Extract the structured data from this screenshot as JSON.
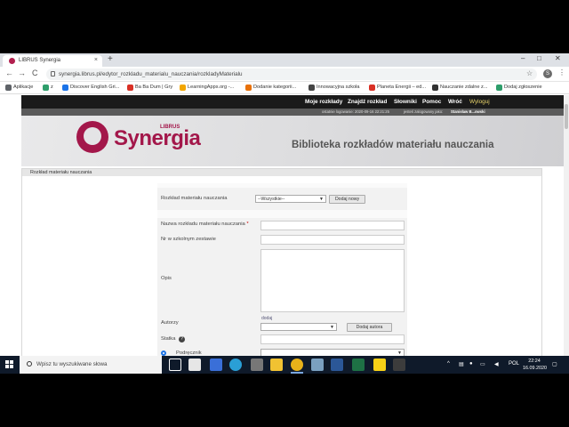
{
  "browser": {
    "tab_title": "LIBRUS Synergia",
    "tab_close": "×",
    "new_tab": "+",
    "url": "synergia.librus.pl/edytor_rozkladu_materialu_nauczania/rozkladyMaterialu",
    "back": "←",
    "forward": "→",
    "reload": "C",
    "star": "☆",
    "profile_initial": "S",
    "menu": "⋮",
    "minimize": "–",
    "maximize": "□",
    "close": "✕",
    "bookmarks": [
      {
        "label": "Aplikacje",
        "color": "#5f6368"
      },
      {
        "label": "z",
        "color": "#2e9e6b"
      },
      {
        "label": "Discover English Gri...",
        "color": "#1a73e8"
      },
      {
        "label": "Ba Ba Dum | Gry",
        "color": "#d93025"
      },
      {
        "label": "LearningApps.org -...",
        "color": "#f2a600"
      },
      {
        "label": "Dodanie kategorii...",
        "color": "#e8710a"
      },
      {
        "label": "Innowacyjna szkoła",
        "color": "#444444"
      },
      {
        "label": "Planeta Energii – ed...",
        "color": "#d93025"
      },
      {
        "label": "Nauczanie zdalne z...",
        "color": "#333333"
      },
      {
        "label": "Dodaj zgłoszenie",
        "color": "#2e9e6b"
      }
    ]
  },
  "nav": {
    "items": [
      "Moje rozkłady",
      "Znajdź rozkład",
      "Słowniki",
      "Pomoc",
      "Wróć",
      "Wyloguj"
    ]
  },
  "infobar": {
    "last_login": "ostatnie logowanie: 2020-09-16 22:21:25",
    "logged_as_label": "jesteś zalogowany jako:",
    "user_name": "Stanisław B...owski"
  },
  "header": {
    "logo_sub": "LIBRUS",
    "logo_text": "Synergia",
    "title": "Biblioteka rozkładów materiału nauczania"
  },
  "panel": {
    "title": "Rozkład materiału nauczania"
  },
  "form": {
    "select_label": "Rozkład materiału nauczania",
    "select_value": "--Wszystkie--",
    "add_new_button": "Dodaj nowy",
    "name_label": "Nazwa rozkładu materiału nauczania",
    "required_mark": "*",
    "school_set_label": "Nr w szkolnym zestawie",
    "description_label": "Opis",
    "authors_label": "Autorzy",
    "authors_hint": "dodaj",
    "add_author_button": "Dodaj autora",
    "status_label": "Statka",
    "help_icon": "?",
    "textbook_label": "Podręcznik"
  },
  "taskbar": {
    "search_placeholder": "Wpisz tu wyszukiwane słowa",
    "language": "POL",
    "time": "22:24",
    "date": "16.09.2020",
    "icons": [
      {
        "name": "task-view",
        "color": "#ffffff"
      },
      {
        "name": "store",
        "color": "#e6e6e6"
      },
      {
        "name": "app-badge",
        "color": "#3a6fd8"
      },
      {
        "name": "edge",
        "color": "#2a9fd6"
      },
      {
        "name": "calculator",
        "color": "#777777"
      },
      {
        "name": "explorer",
        "color": "#f1c232"
      },
      {
        "name": "chrome",
        "color": "#e8b21a"
      },
      {
        "name": "notepad",
        "color": "#7aa0c0"
      },
      {
        "name": "word",
        "color": "#2b5797"
      },
      {
        "name": "excel",
        "color": "#1e7145"
      },
      {
        "name": "sticky",
        "color": "#f7d117"
      },
      {
        "name": "snip",
        "color": "#3c3c3c"
      }
    ]
  }
}
